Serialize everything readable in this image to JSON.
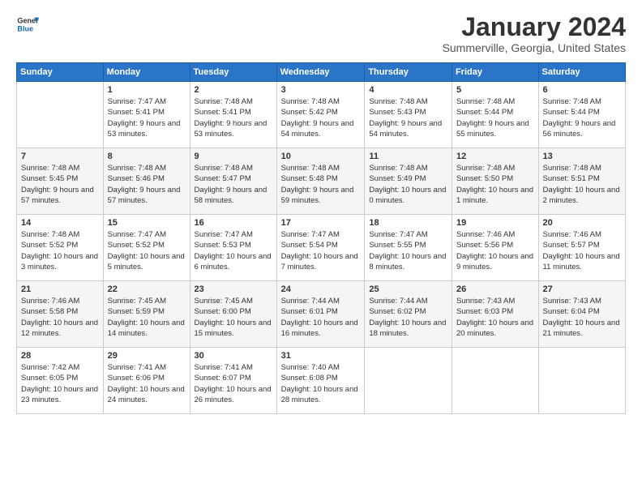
{
  "header": {
    "logo_line1": "General",
    "logo_line2": "Blue",
    "month": "January 2024",
    "location": "Summerville, Georgia, United States"
  },
  "days_of_week": [
    "Sunday",
    "Monday",
    "Tuesday",
    "Wednesday",
    "Thursday",
    "Friday",
    "Saturday"
  ],
  "weeks": [
    [
      {
        "day": "",
        "info": ""
      },
      {
        "day": "1",
        "info": "Sunrise: 7:47 AM\nSunset: 5:41 PM\nDaylight: 9 hours\nand 53 minutes."
      },
      {
        "day": "2",
        "info": "Sunrise: 7:48 AM\nSunset: 5:41 PM\nDaylight: 9 hours\nand 53 minutes."
      },
      {
        "day": "3",
        "info": "Sunrise: 7:48 AM\nSunset: 5:42 PM\nDaylight: 9 hours\nand 54 minutes."
      },
      {
        "day": "4",
        "info": "Sunrise: 7:48 AM\nSunset: 5:43 PM\nDaylight: 9 hours\nand 54 minutes."
      },
      {
        "day": "5",
        "info": "Sunrise: 7:48 AM\nSunset: 5:44 PM\nDaylight: 9 hours\nand 55 minutes."
      },
      {
        "day": "6",
        "info": "Sunrise: 7:48 AM\nSunset: 5:44 PM\nDaylight: 9 hours\nand 56 minutes."
      }
    ],
    [
      {
        "day": "7",
        "info": "Sunrise: 7:48 AM\nSunset: 5:45 PM\nDaylight: 9 hours\nand 57 minutes."
      },
      {
        "day": "8",
        "info": "Sunrise: 7:48 AM\nSunset: 5:46 PM\nDaylight: 9 hours\nand 57 minutes."
      },
      {
        "day": "9",
        "info": "Sunrise: 7:48 AM\nSunset: 5:47 PM\nDaylight: 9 hours\nand 58 minutes."
      },
      {
        "day": "10",
        "info": "Sunrise: 7:48 AM\nSunset: 5:48 PM\nDaylight: 9 hours\nand 59 minutes."
      },
      {
        "day": "11",
        "info": "Sunrise: 7:48 AM\nSunset: 5:49 PM\nDaylight: 10 hours\nand 0 minutes."
      },
      {
        "day": "12",
        "info": "Sunrise: 7:48 AM\nSunset: 5:50 PM\nDaylight: 10 hours\nand 1 minute."
      },
      {
        "day": "13",
        "info": "Sunrise: 7:48 AM\nSunset: 5:51 PM\nDaylight: 10 hours\nand 2 minutes."
      }
    ],
    [
      {
        "day": "14",
        "info": "Sunrise: 7:48 AM\nSunset: 5:52 PM\nDaylight: 10 hours\nand 3 minutes."
      },
      {
        "day": "15",
        "info": "Sunrise: 7:47 AM\nSunset: 5:52 PM\nDaylight: 10 hours\nand 5 minutes."
      },
      {
        "day": "16",
        "info": "Sunrise: 7:47 AM\nSunset: 5:53 PM\nDaylight: 10 hours\nand 6 minutes."
      },
      {
        "day": "17",
        "info": "Sunrise: 7:47 AM\nSunset: 5:54 PM\nDaylight: 10 hours\nand 7 minutes."
      },
      {
        "day": "18",
        "info": "Sunrise: 7:47 AM\nSunset: 5:55 PM\nDaylight: 10 hours\nand 8 minutes."
      },
      {
        "day": "19",
        "info": "Sunrise: 7:46 AM\nSunset: 5:56 PM\nDaylight: 10 hours\nand 9 minutes."
      },
      {
        "day": "20",
        "info": "Sunrise: 7:46 AM\nSunset: 5:57 PM\nDaylight: 10 hours\nand 11 minutes."
      }
    ],
    [
      {
        "day": "21",
        "info": "Sunrise: 7:46 AM\nSunset: 5:58 PM\nDaylight: 10 hours\nand 12 minutes."
      },
      {
        "day": "22",
        "info": "Sunrise: 7:45 AM\nSunset: 5:59 PM\nDaylight: 10 hours\nand 14 minutes."
      },
      {
        "day": "23",
        "info": "Sunrise: 7:45 AM\nSunset: 6:00 PM\nDaylight: 10 hours\nand 15 minutes."
      },
      {
        "day": "24",
        "info": "Sunrise: 7:44 AM\nSunset: 6:01 PM\nDaylight: 10 hours\nand 16 minutes."
      },
      {
        "day": "25",
        "info": "Sunrise: 7:44 AM\nSunset: 6:02 PM\nDaylight: 10 hours\nand 18 minutes."
      },
      {
        "day": "26",
        "info": "Sunrise: 7:43 AM\nSunset: 6:03 PM\nDaylight: 10 hours\nand 20 minutes."
      },
      {
        "day": "27",
        "info": "Sunrise: 7:43 AM\nSunset: 6:04 PM\nDaylight: 10 hours\nand 21 minutes."
      }
    ],
    [
      {
        "day": "28",
        "info": "Sunrise: 7:42 AM\nSunset: 6:05 PM\nDaylight: 10 hours\nand 23 minutes."
      },
      {
        "day": "29",
        "info": "Sunrise: 7:41 AM\nSunset: 6:06 PM\nDaylight: 10 hours\nand 24 minutes."
      },
      {
        "day": "30",
        "info": "Sunrise: 7:41 AM\nSunset: 6:07 PM\nDaylight: 10 hours\nand 26 minutes."
      },
      {
        "day": "31",
        "info": "Sunrise: 7:40 AM\nSunset: 6:08 PM\nDaylight: 10 hours\nand 28 minutes."
      },
      {
        "day": "",
        "info": ""
      },
      {
        "day": "",
        "info": ""
      },
      {
        "day": "",
        "info": ""
      }
    ]
  ]
}
